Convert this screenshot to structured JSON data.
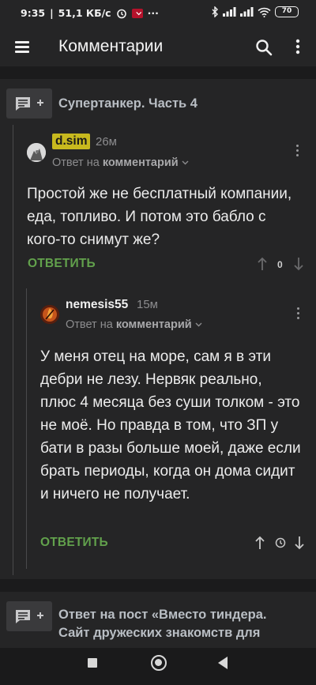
{
  "status_bar": {
    "time": "9:35",
    "speed": "51,1 КБ/с",
    "dots": "···",
    "battery": "70",
    "icons": [
      "alarm-icon",
      "app-notification-icon",
      "bluetooth-icon",
      "signal-icon",
      "wifi-icon",
      "battery-icon"
    ]
  },
  "app_bar": {
    "title": "Комментарии",
    "icons": [
      "menu-icon",
      "search-icon",
      "more-vertical-icon"
    ]
  },
  "posts": [
    {
      "title": "Супертанкер. Часть 4",
      "icon": "add-comment-icon"
    },
    {
      "title": "Ответ на пост «Вместо тиндера. Сайт дружеских знакомств для",
      "icon": "add-comment-icon"
    }
  ],
  "comments": [
    {
      "author": "d.sim",
      "time": "26м",
      "reply_prefix": "Ответ на",
      "reply_target": "комментарий",
      "text": "Простой же не бесплатный компании, еда, топливо. И потом это бабло с кого-то снимут же?",
      "reply_label": "ОТВЕТИТЬ",
      "score": "0",
      "accent": "#c8b91e"
    },
    {
      "author": "nemesis55",
      "time": "15м",
      "reply_prefix": "Ответ на",
      "reply_target": "комментарий",
      "text": "У меня отец на море, сам я в эти дебри не лезу. Нервяк реально, плюс 4 месяца без суши толком - это не моё. Но правда в том, что ЗП у бати в разы больше моей, даже если брать периоды, когда он дома сидит и ничего не получает.",
      "reply_label": "ОТВЕТИТЬ",
      "score_icon": "clock-icon"
    }
  ],
  "colors": {
    "background": "#252526",
    "divider": "#1b1b1c",
    "reply_green": "#62a14c",
    "muted": "#8c8c8e"
  },
  "nav_bar": {
    "icons": [
      "recents-icon",
      "home-icon",
      "back-icon"
    ]
  }
}
